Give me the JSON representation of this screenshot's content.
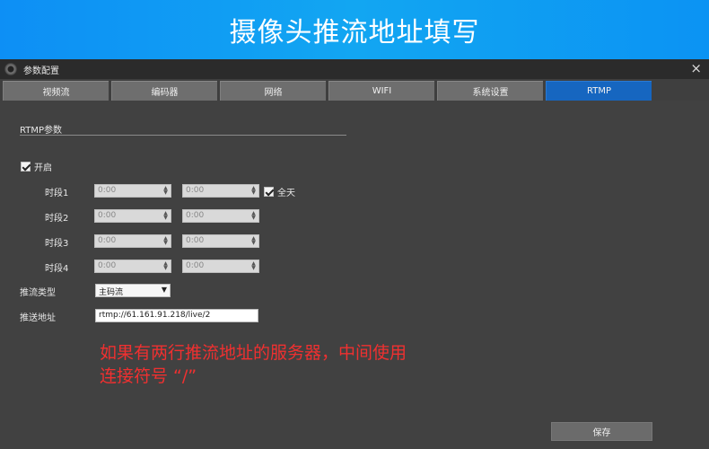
{
  "banner": {
    "title": "摄像头推流地址填写"
  },
  "window": {
    "title": "参数配置",
    "close_icon": "×"
  },
  "tabs": [
    {
      "label": "视频流",
      "active": false
    },
    {
      "label": "编码器",
      "active": false
    },
    {
      "label": "网络",
      "active": false
    },
    {
      "label": "WIFI",
      "active": false
    },
    {
      "label": "系统设置",
      "active": false
    },
    {
      "label": "RTMP",
      "active": true
    }
  ],
  "rtmp": {
    "section_title": "RTMP参数",
    "enable": {
      "label": "开启",
      "checked": true
    },
    "periods": [
      {
        "label": "时段1",
        "start": "0:00",
        "end": "0:00"
      },
      {
        "label": "时段2",
        "start": "0:00",
        "end": "0:00"
      },
      {
        "label": "时段3",
        "start": "0:00",
        "end": "0:00"
      },
      {
        "label": "时段4",
        "start": "0:00",
        "end": "0:00"
      }
    ],
    "allday": {
      "label": "全天",
      "checked": true
    },
    "stream_type": {
      "label": "推流类型",
      "value": "主码流"
    },
    "push_url": {
      "label": "推送地址",
      "value": "rtmp://61.161.91.218/live/2"
    },
    "save_label": "保存"
  },
  "annotation": {
    "line1": "如果有两行推流地址的服务器，中间使用",
    "line2": "连接符号 “/”"
  },
  "colors": {
    "banner": "#0f9cf3",
    "active_tab": "#1666c0",
    "note": "#f03030"
  }
}
